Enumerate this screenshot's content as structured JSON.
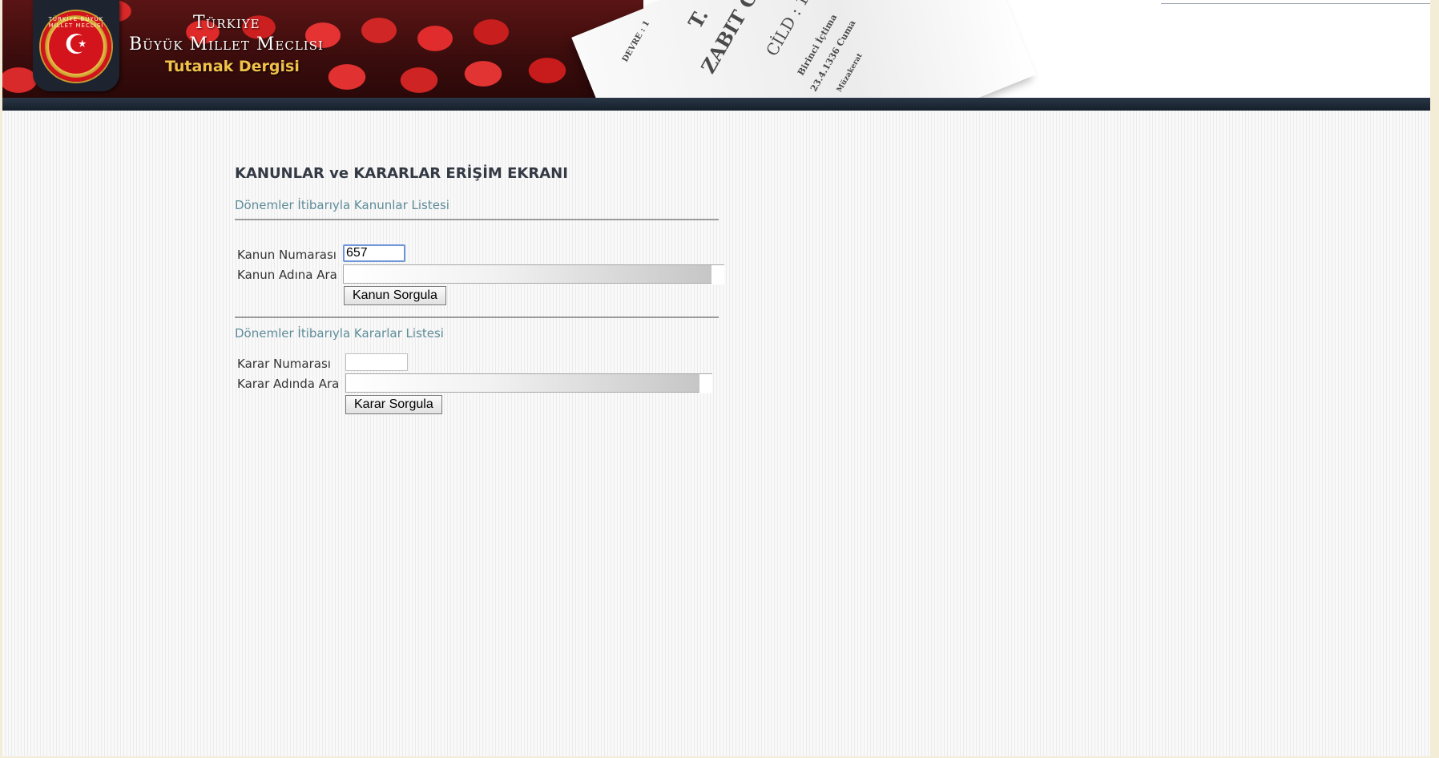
{
  "header": {
    "brand_line1": "Türkiye",
    "brand_line2": "Büyük Millet Meclisi",
    "brand_sub": "Tutanak Dergisi",
    "seal_ring_text": "TÜRKİYE BÜYÜK MİLLET MECLİSİ",
    "paper_texts": [
      "T.",
      "ZABIT C",
      "CİLD : 1",
      "Birinci İçtima",
      "23.4.1336 Cuma",
      "DEVRE : 1",
      "Müzakerat"
    ]
  },
  "page": {
    "title": "KANUNLAR ve KARARLAR ERİŞİM EKRANI"
  },
  "laws": {
    "section_title": "Dönemler İtibarıyla Kanunlar Listesi",
    "number_label": "Kanun Numarası",
    "number_value": "657",
    "name_label": "Kanun Adına Ara",
    "name_value": "",
    "button_label": "Kanun Sorgula"
  },
  "decisions": {
    "section_title": "Dönemler İtibarıyla Kararlar Listesi",
    "number_label": "Karar Numarası",
    "number_value": "",
    "name_label": "Karar Adında Ara",
    "name_value": "",
    "button_label": "Karar Sorgula"
  }
}
